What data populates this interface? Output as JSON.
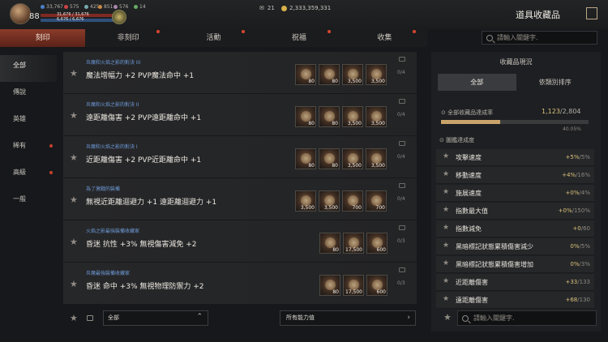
{
  "player": {
    "level": "88",
    "hp": "31,676 / 31,676",
    "mp": "6,676 / 6,676"
  },
  "top_stats": [
    {
      "color": "#4a7fc8",
      "value": "33,767"
    },
    {
      "color": "#c44",
      "value": "575"
    },
    {
      "color": "#7aa",
      "value": "425"
    },
    {
      "color": "#c84",
      "value": "851"
    },
    {
      "color": "#a8a",
      "value": "576"
    },
    {
      "color": "#6a6",
      "value": "14"
    }
  ],
  "mail_count": "21",
  "gold": "2,333,359,331",
  "page_title": "道具收藏品",
  "tabs": [
    {
      "label": "刻印",
      "active": true,
      "dot": false
    },
    {
      "label": "非刻印",
      "active": false,
      "dot": true
    },
    {
      "label": "活動",
      "active": false,
      "dot": true
    },
    {
      "label": "祝福",
      "active": false,
      "dot": true
    },
    {
      "label": "收集",
      "active": false,
      "dot": true
    }
  ],
  "search_placeholder": "請輸入關鍵字.",
  "sidebar": [
    {
      "label": "全部",
      "active": true,
      "dot": false
    },
    {
      "label": "傳說",
      "active": false,
      "dot": false
    },
    {
      "label": "英雄",
      "active": false,
      "dot": false
    },
    {
      "label": "稀有",
      "active": false,
      "dot": true
    },
    {
      "label": "高級",
      "active": false,
      "dot": true
    },
    {
      "label": "一般",
      "active": false,
      "dot": false
    }
  ],
  "collections": [
    {
      "title": "炎魔和火焰之影的對決 III",
      "effect": "魔法增幅力 +2 PVP魔法命中 +1",
      "items": [
        "80",
        "80",
        "3,500",
        "3,500"
      ],
      "progress": "0/4"
    },
    {
      "title": "炎魔和火焰之影的對決 II",
      "effect": "遠距離傷害 +2 PVP遠距離命中 +1",
      "items": [
        "80",
        "80",
        "3,500",
        "3,500"
      ],
      "progress": "0/4"
    },
    {
      "title": "炎魔和火焰之影的對決 I",
      "effect": "近距離傷害 +2 PVP近距離命中 +1",
      "items": [
        "80",
        "80",
        "3,500",
        "3,500"
      ],
      "progress": "0/4"
    },
    {
      "title": "為了激戰的裝備",
      "effect": "無視近距離迴避力 +1 遠距離迴避力 +1",
      "items": [
        "3,500",
        "3,500",
        "700",
        "700"
      ],
      "progress": "0/4"
    },
    {
      "title": "火焰之影最強裝備收藏家",
      "effect": "昏迷 抗性 +3% 無視傷害減免 +2",
      "items": [
        "80",
        "17,500",
        "600"
      ],
      "progress": "0/3"
    },
    {
      "title": "炎魔最強裝備收藏家",
      "effect": "昏迷 命中 +3% 無視物理防禦力 +2",
      "items": [
        "80",
        "17,500",
        "600"
      ],
      "progress": "0/3"
    }
  ],
  "filter_all": "全部",
  "filter_abilities": "所有能力值",
  "right_panel": {
    "title": "收藏品現況",
    "tabs": [
      "全部",
      "依類別排序"
    ],
    "total_label": "全部收藏品達成率",
    "total_current": "1,123",
    "total_max": "/2,804",
    "total_fraction": 0.4005,
    "total_pct": "40.05%",
    "group_label": "圖鑑達成度",
    "stats": [
      {
        "name": "攻擊速度",
        "cur": "+5%",
        "max": "/5%"
      },
      {
        "name": "移動速度",
        "cur": "+4%",
        "max": "/16%"
      },
      {
        "name": "施展速度",
        "cur": "+0%",
        "max": "/4%"
      },
      {
        "name": "指數最大值",
        "cur": "+0%",
        "max": "/150%"
      },
      {
        "name": "指數減免",
        "cur": "+0",
        "max": "/60"
      },
      {
        "name": "黑暗標記狀態累積傷害減少",
        "cur": "0%",
        "max": "/5%"
      },
      {
        "name": "黑暗標記狀態累積傷害增加",
        "cur": "0%",
        "max": "/3%"
      },
      {
        "name": "近距離傷害",
        "cur": "+33",
        "max": "/133"
      },
      {
        "name": "遠距離傷害",
        "cur": "+68",
        "max": "/130"
      }
    ],
    "search_placeholder": "請輸入關鍵字."
  }
}
